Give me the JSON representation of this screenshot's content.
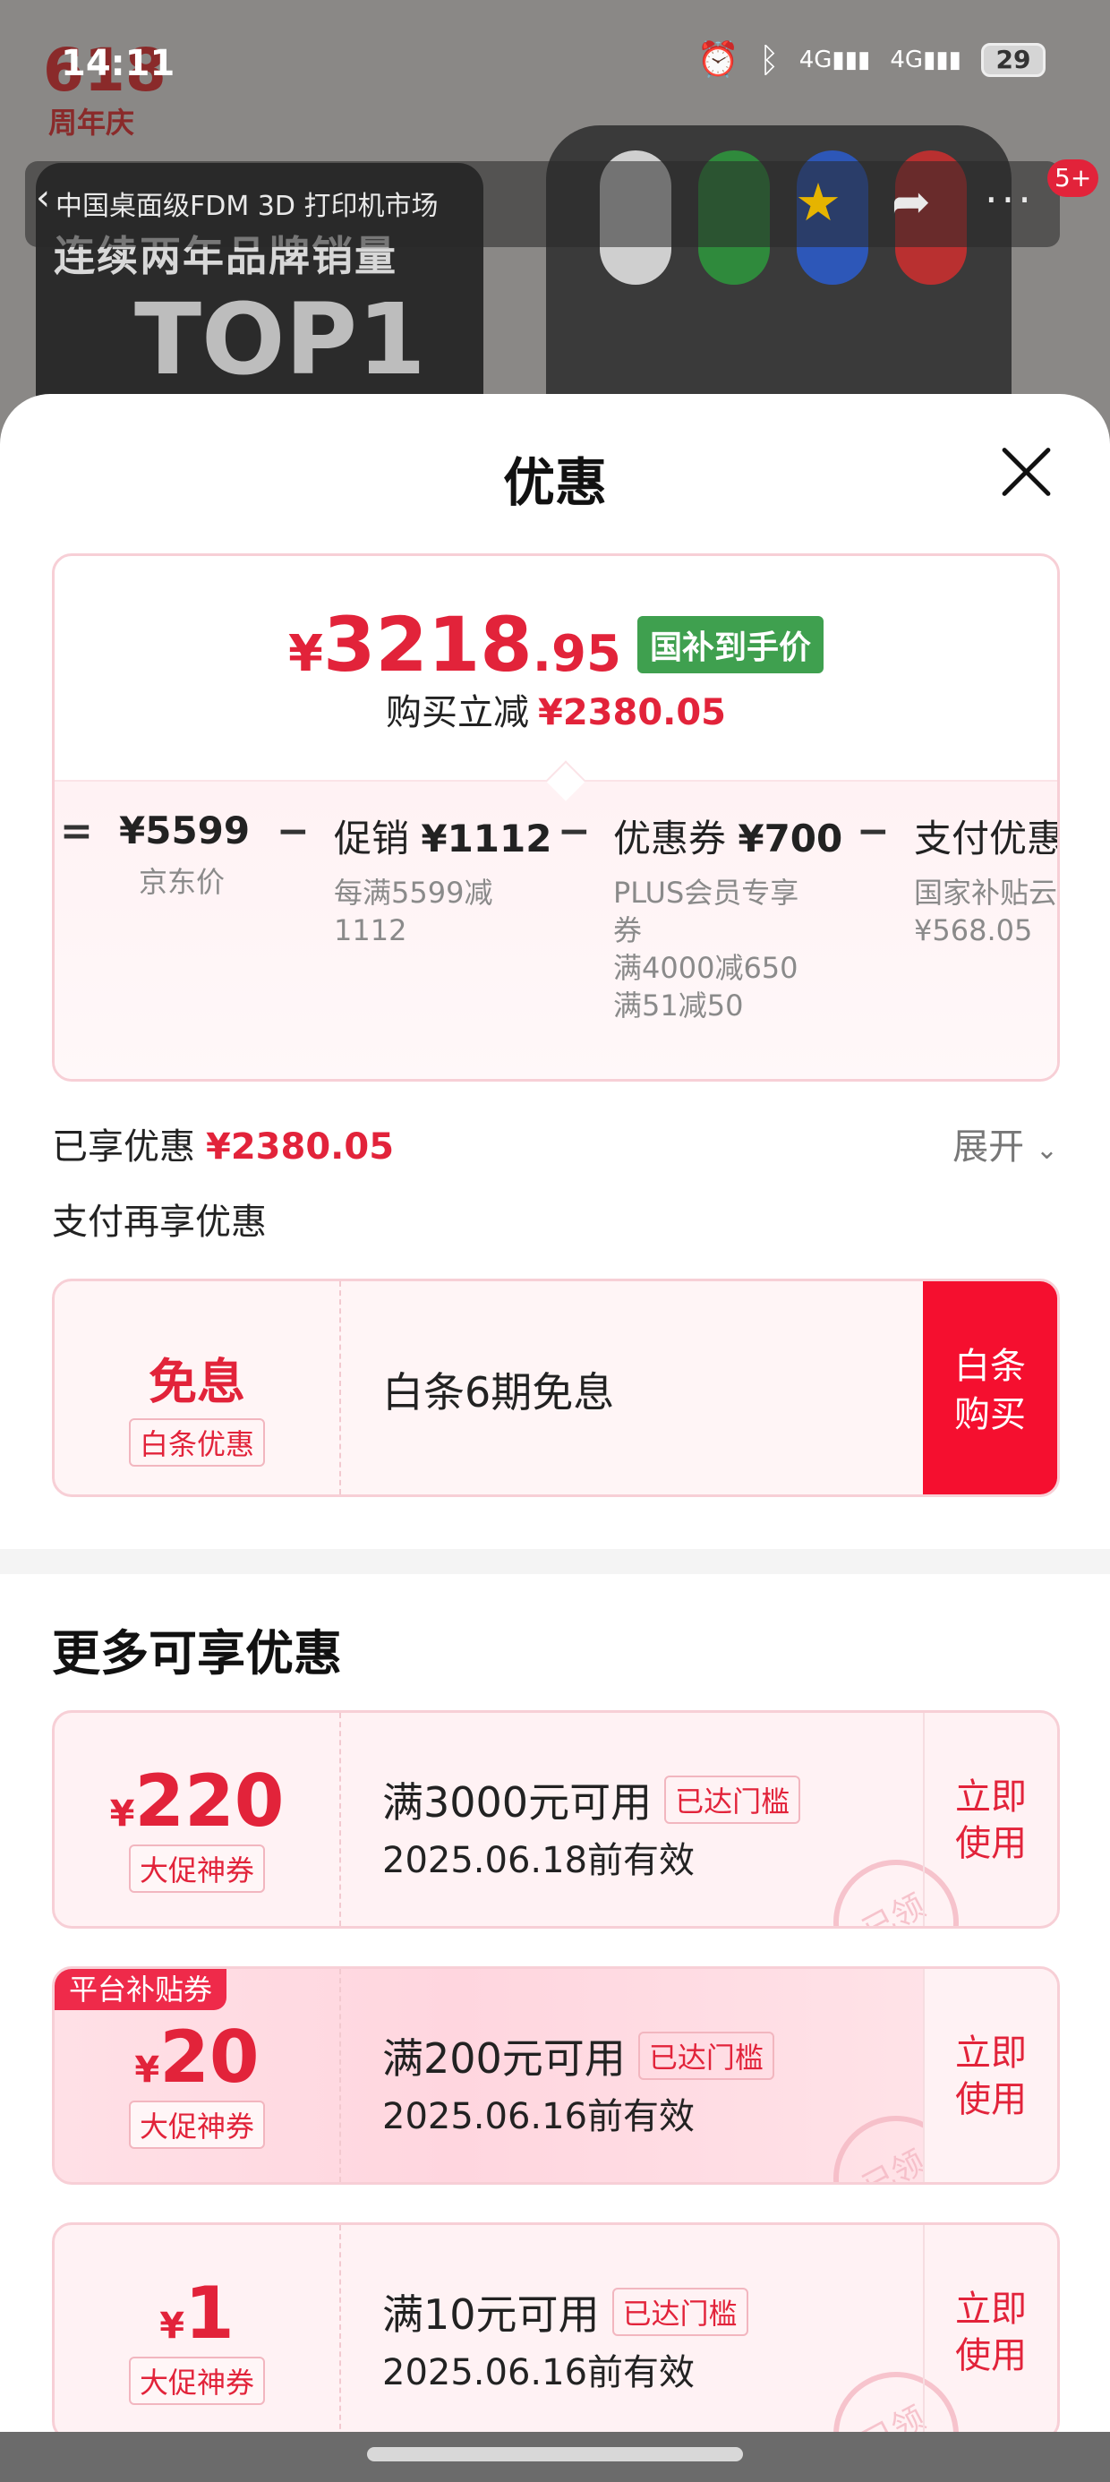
{
  "status_bar": {
    "time": "14:11",
    "battery": "29",
    "network_1": "4G",
    "network_2": "4G"
  },
  "background": {
    "logo_618": "618",
    "logo_618_sub": "周年庆",
    "breadcrumb": "中国桌面级FDM 3D 打印机市场",
    "banner_title": "连续两年品牌销量",
    "banner_top1": "TOP1",
    "message_badge": "5+"
  },
  "sheet": {
    "title": "优惠"
  },
  "price_summary": {
    "final_yen": "¥",
    "final_int": "3218",
    "final_dec": ".95",
    "gov_tag": "国补到手价",
    "reduce_label": "购买立减",
    "reduce_amount": "¥2380.05",
    "breakdown": [
      {
        "op": "=",
        "main_label": "",
        "main_value": "¥5599",
        "sub": "京东价"
      },
      {
        "op": "−",
        "main_label": "促销 ",
        "main_value": "¥1112",
        "sub": "每满5599减\n1112"
      },
      {
        "op": "−",
        "main_label": "优惠券 ",
        "main_value": "¥700",
        "sub": "PLUS会员专享\n券\n满4000减650\n满51减50"
      },
      {
        "op": "−",
        "main_label": "支付优惠",
        "main_value": "",
        "sub": "国家补贴云\n¥568.05"
      }
    ]
  },
  "enjoyed": {
    "label": "已享优惠",
    "amount": "¥2380.05",
    "expand_label": "展开"
  },
  "pay_more_label": "支付再享优惠",
  "baitiao": {
    "big": "免息",
    "tag": "白条优惠",
    "text": "白条6期免息",
    "button": "白条\n购买"
  },
  "more_title": "更多可享优惠",
  "coupons": [
    {
      "yen": "¥",
      "amount": "220",
      "tag": "大促神券",
      "condition": "满3000元可用",
      "reach": "已达门槛",
      "date": "2025.06.18前有效",
      "use": "立即\n使用",
      "stamp": "已领",
      "platform": ""
    },
    {
      "yen": "¥",
      "amount": "20",
      "tag": "大促神券",
      "condition": "满200元可用",
      "reach": "已达门槛",
      "date": "2025.06.16前有效",
      "use": "立即\n使用",
      "stamp": "已领",
      "platform": "平台补贴券"
    },
    {
      "yen": "¥",
      "amount": "1",
      "tag": "大促神券",
      "condition": "满10元可用",
      "reach": "已达门槛",
      "date": "2025.06.16前有效",
      "use": "立即\n使用",
      "stamp": "已领",
      "platform": ""
    }
  ],
  "colors": {
    "accent_red": "#e2233a",
    "button_red": "#f50f2f",
    "gov_green": "#3fa04f"
  }
}
